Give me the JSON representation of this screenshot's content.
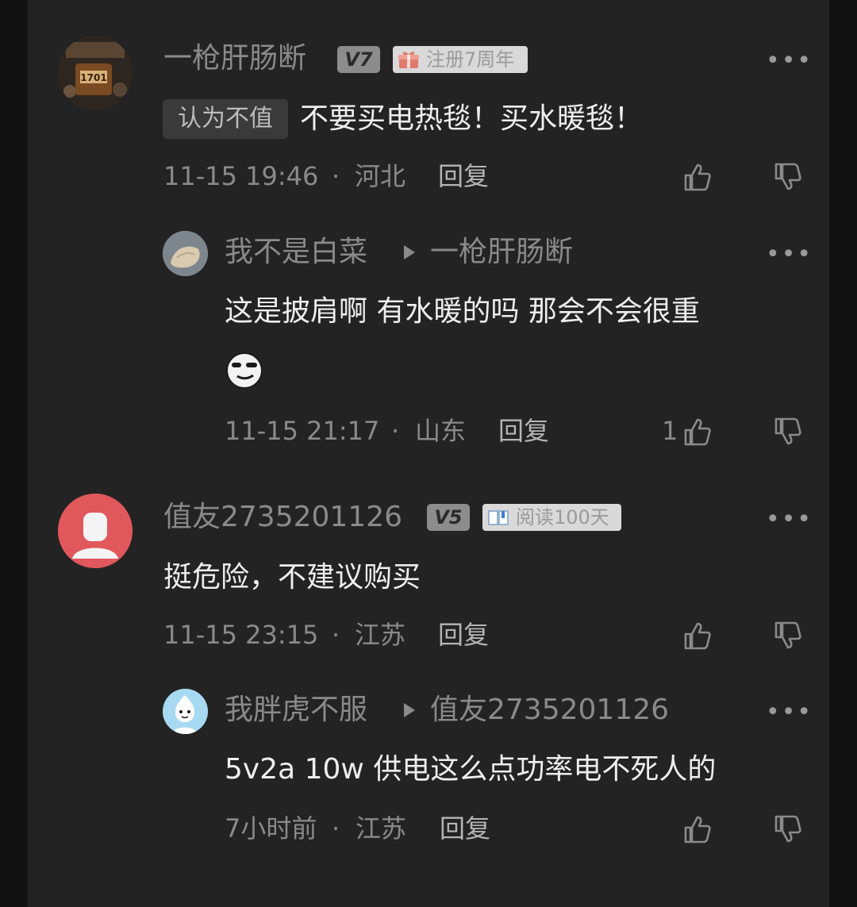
{
  "comments": [
    {
      "username": "一枪肝肠断",
      "level": "V7",
      "tag": "注册7周年",
      "rating_label": "认为不值",
      "text": "不要买电热毯！买水暖毯！",
      "time": "11-15 19:46",
      "location": "河北",
      "reply_label": "回复",
      "avatar_text": "1701"
    },
    {
      "username": "我不是白菜",
      "reply_to": "一枪肝肠断",
      "text": "这是披肩啊 有水暖的吗 那会不会很重",
      "time": "11-15 21:17",
      "location": "山东",
      "reply_label": "回复",
      "likes": "1"
    },
    {
      "username": "值友2735201126",
      "level": "V5",
      "tag": "阅读100天",
      "text": "挺危险，不建议购买",
      "time": "11-15 23:15",
      "location": "江苏",
      "reply_label": "回复"
    },
    {
      "username": "我胖虎不服",
      "reply_to": "值友2735201126",
      "text": "5v2a 10w 供电这么点功率电不死人的",
      "time": "7小时前",
      "location": "江苏",
      "reply_label": "回复"
    }
  ],
  "separator": "·",
  "more_glyph": "•••",
  "icons": [
    "more-icon",
    "thumbs-up-icon",
    "thumbs-down-icon",
    "reply-arrow-icon",
    "emoji-icon",
    "gift-icon",
    "book-icon"
  ],
  "colors": {
    "background": "#232323",
    "text": "#eeeeee",
    "muted": "#8a8a8a"
  }
}
